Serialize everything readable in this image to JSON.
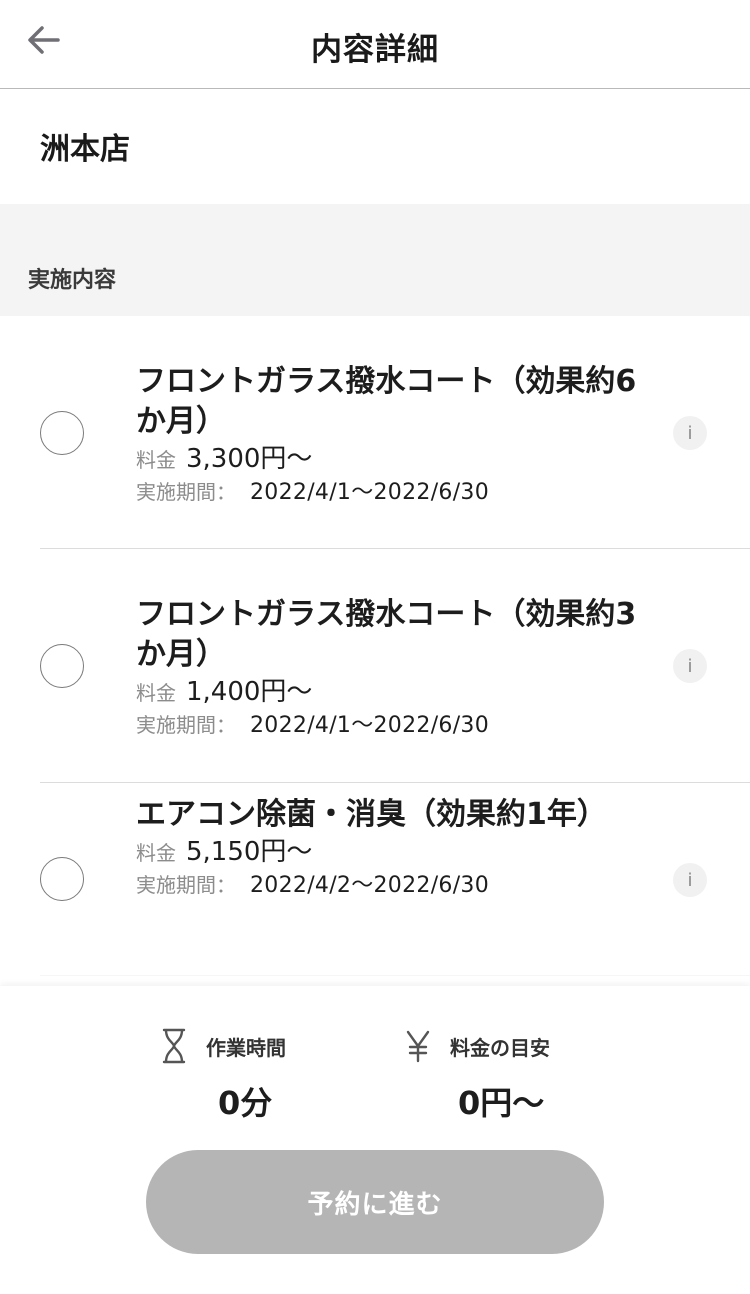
{
  "header": {
    "title": "内容詳細"
  },
  "store": {
    "name": "洲本店"
  },
  "section": {
    "label": "実施内容"
  },
  "items": [
    {
      "name": "フロントガラス撥水コート（効果約6か月）",
      "price_label": "料金",
      "price": "3,300円〜",
      "period_label": "実施期間：",
      "period": "2022/4/1〜2022/6/30",
      "selected": false
    },
    {
      "name": "フロントガラス撥水コート（効果約3か月）",
      "price_label": "料金",
      "price": "1,400円〜",
      "period_label": "実施期間：",
      "period": "2022/4/1〜2022/6/30",
      "selected": false
    },
    {
      "name": "エアコン除菌・消臭（効果約1年）",
      "price_label": "料金",
      "price": "5,150円〜",
      "period_label": "実施期間：",
      "period": "2022/4/2〜2022/6/30",
      "selected": false
    }
  ],
  "info_glyph": "i",
  "summary": {
    "time_label": "作業時間",
    "time_value": "0分",
    "price_label": "料金の目安",
    "price_value": "0円〜",
    "time_icon": "hourglass-icon",
    "price_icon": "yen-icon"
  },
  "reserve_button": {
    "label": "予約に進む",
    "enabled": false
  },
  "colors": {
    "button_disabled": "#b5b5b5",
    "section_bg": "#f4f4f4",
    "muted_text": "#8c8c8c"
  }
}
